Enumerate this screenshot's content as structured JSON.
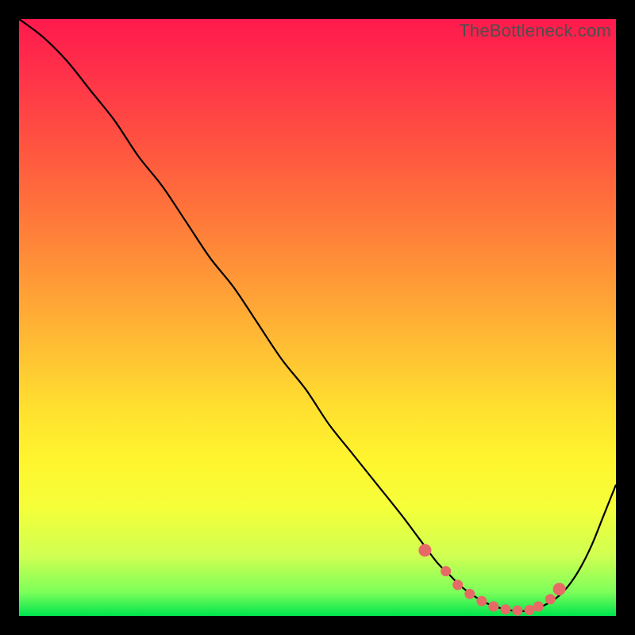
{
  "watermark": "TheBottleneck.com",
  "colors": {
    "frame_bg": "#000000",
    "curve": "#000000",
    "marker": "#e86a66",
    "gradient_top": "#ff1a4d",
    "gradient_bottom": "#00e44e"
  },
  "chart_data": {
    "type": "line",
    "title": "",
    "xlabel": "",
    "ylabel": "",
    "xlim": [
      0,
      100
    ],
    "ylim": [
      0,
      100
    ],
    "grid": false,
    "legend": false,
    "series": [
      {
        "name": "bottleneck-curve",
        "x": [
          0,
          4,
          8,
          12,
          16,
          20,
          24,
          28,
          32,
          36,
          40,
          44,
          48,
          52,
          56,
          60,
          64,
          67,
          70,
          72,
          74,
          76,
          78,
          80,
          82,
          84,
          86,
          88,
          90,
          92,
          94,
          96,
          98,
          100
        ],
        "values": [
          100,
          97,
          93,
          88,
          83,
          77,
          72,
          66,
          60,
          55,
          49,
          43,
          38,
          32,
          27,
          22,
          17,
          13,
          9,
          7,
          5,
          3.5,
          2.3,
          1.5,
          1.0,
          0.8,
          1.0,
          1.8,
          3.0,
          5.0,
          8.0,
          12,
          17,
          22
        ]
      }
    ],
    "markers": {
      "name": "highlight-dots",
      "x": [
        68,
        71.5,
        73.5,
        75.5,
        77.5,
        79.5,
        81.5,
        83.5,
        85.5,
        87,
        89,
        90.5
      ],
      "values": [
        11,
        7.5,
        5.2,
        3.7,
        2.5,
        1.6,
        1.1,
        0.9,
        1.0,
        1.6,
        2.8,
        4.5
      ]
    }
  }
}
